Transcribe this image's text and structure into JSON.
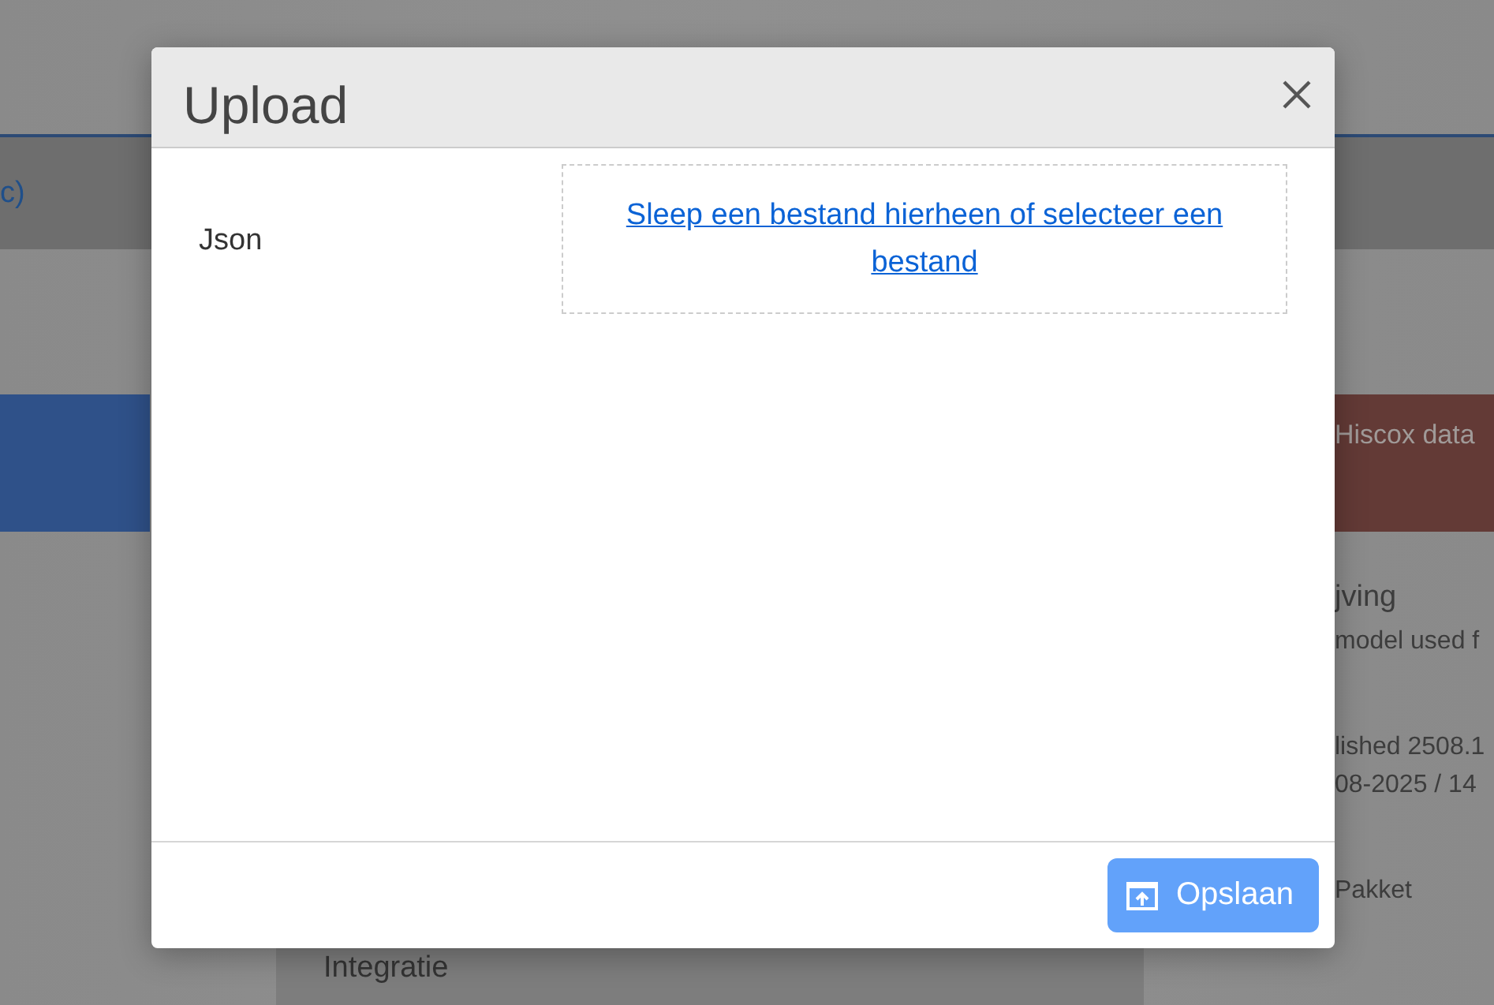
{
  "background": {
    "band_link": "c)",
    "right_panel_title": "Hiscox data",
    "right_texts": [
      "jving",
      "model used f",
      "lished 2508.1",
      "08-2025 / 14",
      "Pakket"
    ],
    "bottom_card_title": "Integratie"
  },
  "dialog": {
    "title": "Upload",
    "field_label": "Json",
    "dropzone_link": "Sleep een bestand hierheen of selecteer een bestand",
    "save_button": "Opslaan"
  }
}
